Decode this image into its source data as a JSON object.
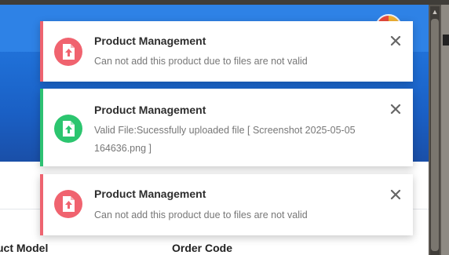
{
  "notifications": [
    {
      "type": "error",
      "icon": "file-upload-icon",
      "title": "Product Management",
      "message": "Can not add this product due to files are not valid",
      "accent": "#ee6470"
    },
    {
      "type": "success",
      "icon": "file-upload-icon",
      "title": "Product Management",
      "message": "Valid File:Sucessfully uploaded file [ Screenshot 2025-05-05 164636.png ]",
      "accent": "#2ec172"
    },
    {
      "type": "error",
      "icon": "file-upload-icon",
      "title": "Product Management",
      "message": "Can not add this product due to files are not valid",
      "accent": "#ee6470"
    }
  ],
  "table": {
    "columns": [
      "uct Model",
      "Order Code"
    ]
  },
  "colors": {
    "header": "#2e82e6",
    "error": "#f0636f",
    "success": "#2cc56f"
  }
}
